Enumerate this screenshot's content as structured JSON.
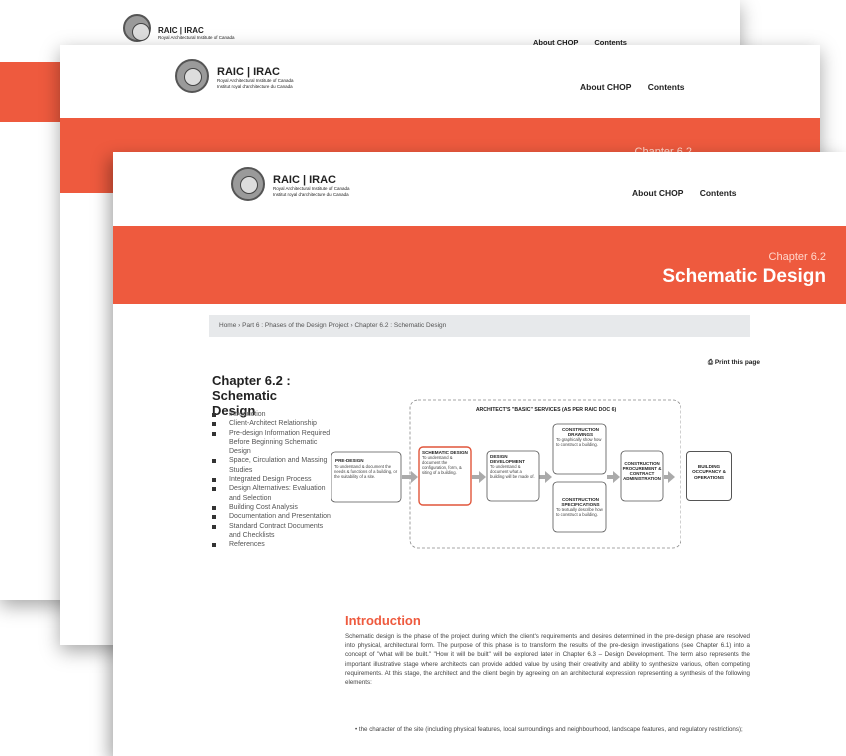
{
  "brand": {
    "name": "RAIC | IRAC",
    "line1": "Royal Architectural Institute of Canada",
    "line2": "Institut royal d'architecture du Canada"
  },
  "nav": {
    "about": "About CHOP",
    "contents": "Contents"
  },
  "banner": {
    "chapter": "Chapter 6.2",
    "title": "Schematic Design"
  },
  "breadcrumb": "Home  ›  Part 6 : Phases of the Design Project  ›  Chapter 6.2 : Schematic Design",
  "print_label": "Print this page",
  "sidebar": {
    "title": "Chapter 6.2 : Schematic Design",
    "items": [
      "Introduction",
      "Client-Architect Relationship",
      "Pre-design Information Required Before Beginning Schematic Design",
      "Space, Circulation and Massing Studies",
      "Integrated Design Process",
      "Design Alternatives: Evaluation and Selection",
      "Building Cost Analysis",
      "Documentation and Presentation",
      "Standard Contract Documents and Checklists",
      "References"
    ]
  },
  "diagram": {
    "heading": "ARCHITECT'S \"BASIC\" SERVICES (AS PER RAIC DOC 6)",
    "predesign_title": "PRE-DESIGN",
    "predesign_text": "To understand & document the needs & functions of a building, or the suitability of a site.",
    "schematic_title": "SCHEMATIC DESIGN",
    "schematic_text": "To understand & document the configuration, form, & siting of a building.",
    "dd_title": "DESIGN DEVELOPMENT",
    "dd_text": "To understand & document what a building will be made of.",
    "cd_title": "CONSTRUCTION DRAWINGS",
    "cd_text": "To graphically show how to construct a building.",
    "cs_title": "CONSTRUCTION SPECIFICATIONS",
    "cs_text": "To textually describe how to construct a building.",
    "cp_title": "CONSTRUCTION PROCUREMENT & CONTRACT ADMINISTRATION",
    "bo_title": "BUILDING OCCUPANCY & OPERATIONS"
  },
  "intro": {
    "heading": "Introduction",
    "para": "Schematic design is the phase of the project during which the client's requirements and desires determined in the pre-design phase are resolved into physical, architectural form. The purpose of this phase is to transform the results of the pre-design investigations (see Chapter 6.1) into a concept of \"what will be built.\" \"How it will be built\" will be explored later in Chapter 6.3 – Design Development. The term also represents the important illustrative stage where architects can provide added value by using their creativity and ability to synthesize various, often competing requirements. At this stage, the architect and the client begin by agreeing on an architectural expression representing a synthesis of the following elements:",
    "bullet1": "the character of the site (including physical features, local surroundings and neighbourhood, landscape features, and regulatory restrictions);"
  },
  "colors": {
    "accent": "#ee5a3e",
    "breadcrumb_bg": "#e7e9eb"
  }
}
